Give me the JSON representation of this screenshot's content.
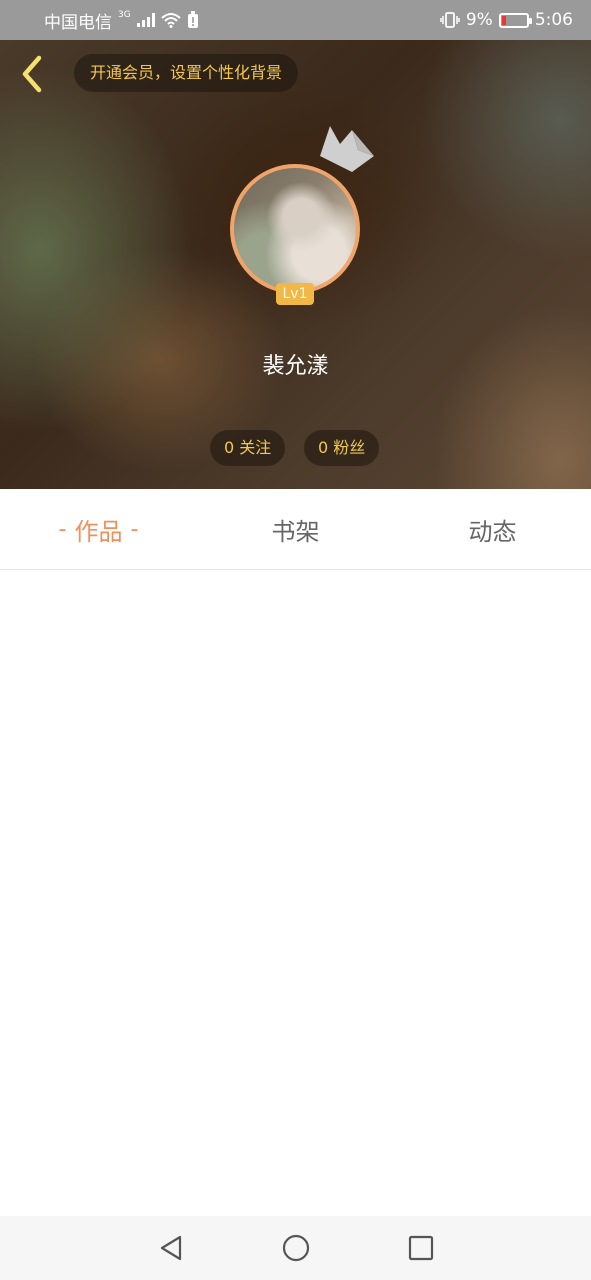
{
  "status_bar": {
    "carrier": "中国电信",
    "network": "3G",
    "battery_percent": "9%",
    "time": "5:06"
  },
  "header": {
    "vip_banner": "开通会员，设置个性化背景",
    "level": "Lv1",
    "username": "裴允漾",
    "following": "0 关注",
    "fans": "0 粉丝"
  },
  "tabs": [
    {
      "label": "作品",
      "active": true
    },
    {
      "label": "书架",
      "active": false
    },
    {
      "label": "动态",
      "active": false
    }
  ],
  "colors": {
    "accent": "#f0905a",
    "gold": "#f3c84b",
    "badge": "#f1b747"
  },
  "icons": {
    "back": "chevron-left-icon",
    "crown": "crown-icon",
    "nav_back": "triangle-back-icon",
    "nav_home": "circle-home-icon",
    "nav_recent": "square-recent-icon"
  }
}
